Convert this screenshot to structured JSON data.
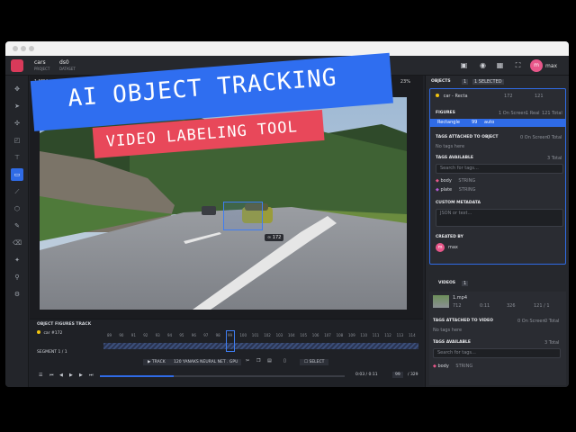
{
  "topbar": {
    "project_name": "cars",
    "project_label": "PROJECT",
    "dataset_name": "ds0",
    "dataset_label": "DATASET",
    "user_initial": "m",
    "user_name": "max"
  },
  "viewport": {
    "file_name": "1.MP4",
    "zoom": "23%",
    "bbox_label": "172"
  },
  "overlay": {
    "headline": "AI OBJECT TRACKING",
    "subheadline": "VIDEO LABELING TOOL"
  },
  "timeline": {
    "track_title": "OBJECT FIGURES TRACK",
    "object_label": "car",
    "object_id": "#172",
    "segment_label": "SEGMENT 1 / 1",
    "frame_numbers": [
      "89",
      "90",
      "91",
      "92",
      "93",
      "94",
      "95",
      "96",
      "97",
      "98",
      "99",
      "100",
      "101",
      "102",
      "103",
      "104",
      "105",
      "106",
      "107",
      "108",
      "109",
      "110",
      "111",
      "112",
      "113",
      "114"
    ],
    "track_button": "TRACK",
    "model_name": "120 YANAKS NEURAL NET . GPU",
    "select_button": "SELECT",
    "time": "0:03 / 0:11",
    "current_frame": "99",
    "total_frames": "/ 329",
    "progress_fraction": 0.3
  },
  "objects_panel": {
    "title": "OBJECTS",
    "count": "1",
    "selected": "1 SELECTED",
    "object_name": "car - Recta",
    "object_count_a": "172",
    "object_count_b": "121",
    "figures_label": "FIGURES",
    "on_screen": "1 On Screen",
    "real": "1 Real",
    "total": "121 Total",
    "figure_type": "Rectangle",
    "figure_frames": "99",
    "figure_mode": "auto",
    "tags_attached_label": "TAGS ATTACHED TO OBJECT",
    "tags_on_screen": "0 On Screen",
    "tags_total": "0 Total",
    "no_tags": "No tags here",
    "tags_available_label": "TAGS AVAILABLE",
    "tags_available_total": "3 Total",
    "search_placeholder": "Search for tags...",
    "tags": [
      {
        "name": "body",
        "type": "STRING"
      },
      {
        "name": "plate",
        "type": "STRING"
      }
    ],
    "custom_metadata_label": "CUSTOM METADATA",
    "json_placeholder": "JSON or text...",
    "created_by_label": "CREATED BY",
    "creator_initial": "m",
    "creator_name": "max"
  },
  "videos_panel": {
    "title": "VIDEOS",
    "count": "1",
    "video_name": "1.mp4",
    "stat_a": "712",
    "stat_b": "0:11",
    "stat_c": "326",
    "stat_d": "121 / 1",
    "tags_attached_label": "TAGS ATTACHED TO VIDEO",
    "tags_on_screen": "0 On Screen",
    "tags_total": "0 Total",
    "no_tags": "No tags here",
    "tags_available_label": "TAGS AVAILABLE",
    "tags_available_total": "3 Total",
    "search_placeholder": "Search for tags...",
    "tag_name": "body",
    "tag_type": "STRING"
  },
  "colors": {
    "accent": "#2f6be6",
    "headline_bg": "#2f6ef0",
    "subheadline_bg": "#e8485a",
    "tag_body": "#e8578a",
    "tag_plate": "#b45cd6"
  }
}
